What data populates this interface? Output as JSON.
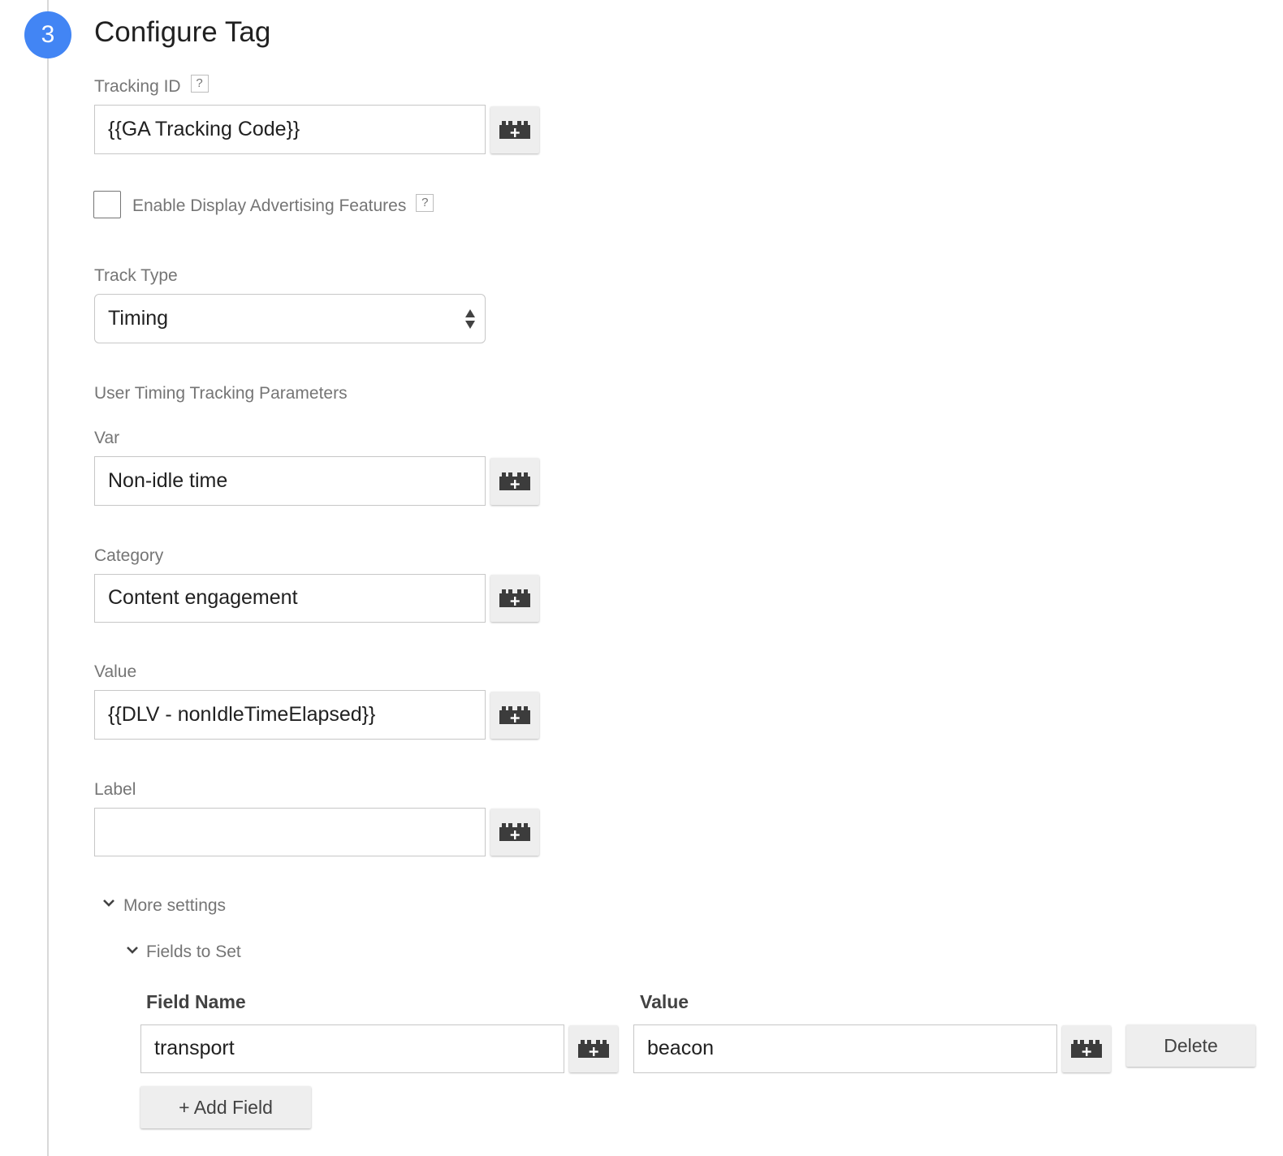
{
  "step": {
    "number": "3",
    "title": "Configure Tag"
  },
  "tracking_id": {
    "label": "Tracking ID",
    "help": "?",
    "value": "{{GA Tracking Code}}"
  },
  "display_features": {
    "label": "Enable Display Advertising Features",
    "help": "?",
    "checked": false
  },
  "track_type": {
    "label": "Track Type",
    "selected": "Timing"
  },
  "params": {
    "section_title": "User Timing Tracking Parameters",
    "var": {
      "label": "Var",
      "value": "Non-idle time"
    },
    "category": {
      "label": "Category",
      "value": "Content engagement"
    },
    "value": {
      "label": "Value",
      "value": "{{DLV - nonIdleTimeElapsed}}"
    },
    "label": {
      "label": "Label",
      "value": ""
    }
  },
  "more_settings": {
    "label": "More settings",
    "expanded": true
  },
  "fields_to_set": {
    "label": "Fields to Set",
    "expanded": true,
    "field_name_header": "Field Name",
    "value_header": "Value",
    "rows": [
      {
        "field_name": "transport",
        "value": "beacon"
      }
    ],
    "delete_label": "Delete",
    "add_field_label": "+ Add Field"
  },
  "colors": {
    "accent": "#4285f4",
    "label": "#757575",
    "border": "#c7c7c7",
    "button_bg": "#eeeeee",
    "icon": "#3c3c3c"
  },
  "icons": {
    "variable_button": "variable-brick-plus-icon",
    "chevron": "chevron-down-icon",
    "select": "select-arrows-icon"
  }
}
